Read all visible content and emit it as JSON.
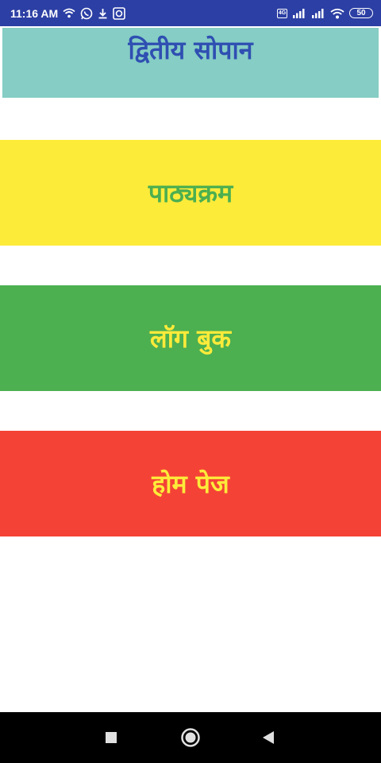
{
  "status_bar": {
    "time": "11:16 AM",
    "network_badge": "4G",
    "battery": "50"
  },
  "header": {
    "title": "द्वितीय सोपान"
  },
  "menu": {
    "items": [
      {
        "label": "पाठ्यक्रम"
      },
      {
        "label": "लॉग बुक"
      },
      {
        "label": "होम पेज"
      }
    ]
  },
  "colors": {
    "status_bar": "#2c3fa4",
    "header_bg": "#85cdc5",
    "header_text": "#2f4fb2",
    "yellow": "#fdeb3a",
    "green": "#4caf50",
    "red": "#f44336"
  },
  "icons": {
    "status_left": [
      "wifi-icon",
      "whatsapp-icon",
      "download-icon",
      "app-notification-icon"
    ],
    "status_right": [
      "network-badge-icon",
      "signal-icon",
      "signal-icon",
      "wifi-icon",
      "battery-icon"
    ],
    "nav": [
      "recents-square-icon",
      "home-circle-icon",
      "back-triangle-icon"
    ]
  }
}
